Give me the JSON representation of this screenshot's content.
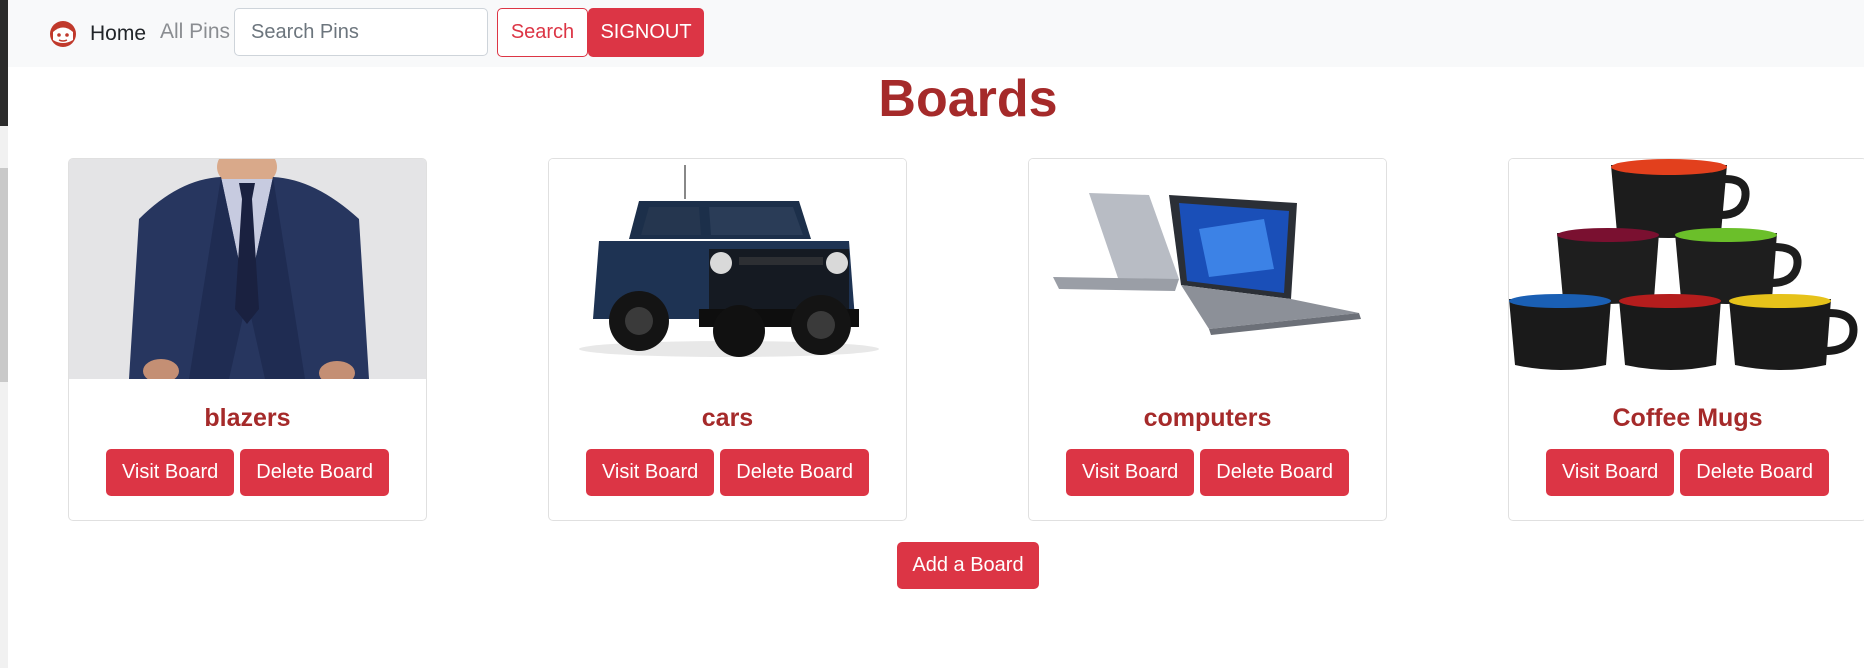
{
  "colors": {
    "accent": "#dc3545",
    "title": "#a52a2a",
    "navbar_bg": "#f8f9fa"
  },
  "navbar": {
    "brand_icon": "face-icon",
    "home_label": "Home",
    "all_pins_label": "All Pins",
    "search_placeholder": "Search Pins",
    "search_value": "",
    "search_button_label": "Search",
    "signout_label": "SIGNOUT"
  },
  "main": {
    "title": "Boards",
    "add_board_label": "Add a Board",
    "boards": [
      {
        "name": "blazers",
        "image": "blazer-photo",
        "visit_label": "Visit Board",
        "delete_label": "Delete Board"
      },
      {
        "name": "cars",
        "image": "car-photo",
        "visit_label": "Visit Board",
        "delete_label": "Delete Board"
      },
      {
        "name": "computers",
        "image": "laptop-photo",
        "visit_label": "Visit Board",
        "delete_label": "Delete Board"
      },
      {
        "name": "Coffee Mugs",
        "image": "mugs-photo",
        "visit_label": "Visit Board",
        "delete_label": "Delete Board"
      }
    ]
  }
}
